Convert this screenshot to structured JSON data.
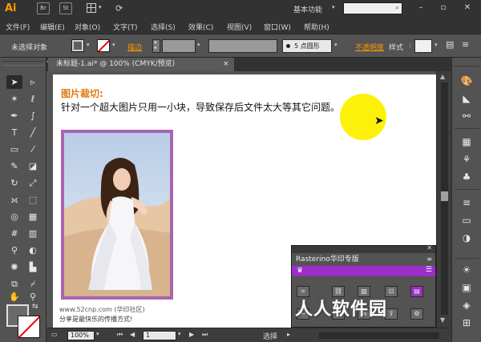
{
  "app": {
    "logo": "Ai",
    "bridge_label": "Br",
    "stock_label": "St",
    "workspace": "基本功能",
    "sync_icon": "sync-settings-icon"
  },
  "menu": [
    "文件(F)",
    "编辑(E)",
    "对象(O)",
    "文字(T)",
    "选择(S)",
    "效果(C)",
    "视图(V)",
    "窗口(W)",
    "帮助(H)"
  ],
  "control_bar": {
    "selection_status": "未选择对象",
    "stroke_label": "描边",
    "brush_value": "5 点圆形",
    "opacity_label": "不透明度",
    "style_label": "样式"
  },
  "document": {
    "tab_title": "未标题-1.ai* @ 100% (CMYK/预览)",
    "close_glyph": "×"
  },
  "artboard": {
    "heading": "图片裁切:",
    "body": "针对一个超大图片只用一小块，导致保存后文件太大等其它问题。",
    "caption_site": "www.52cnp.com (华印社区)",
    "caption_slogan": "分享是最快乐的传播方式!",
    "watermark": "人人软件园",
    "frame_color": "#a865b0",
    "highlight_color": "#fdf10a"
  },
  "rasterino_panel": {
    "title": "Rasterino华印专版",
    "accent_color": "#9b2fc7"
  },
  "status_bar": {
    "zoom": "100%",
    "artboard_number": "1",
    "current_tool": "选择"
  }
}
